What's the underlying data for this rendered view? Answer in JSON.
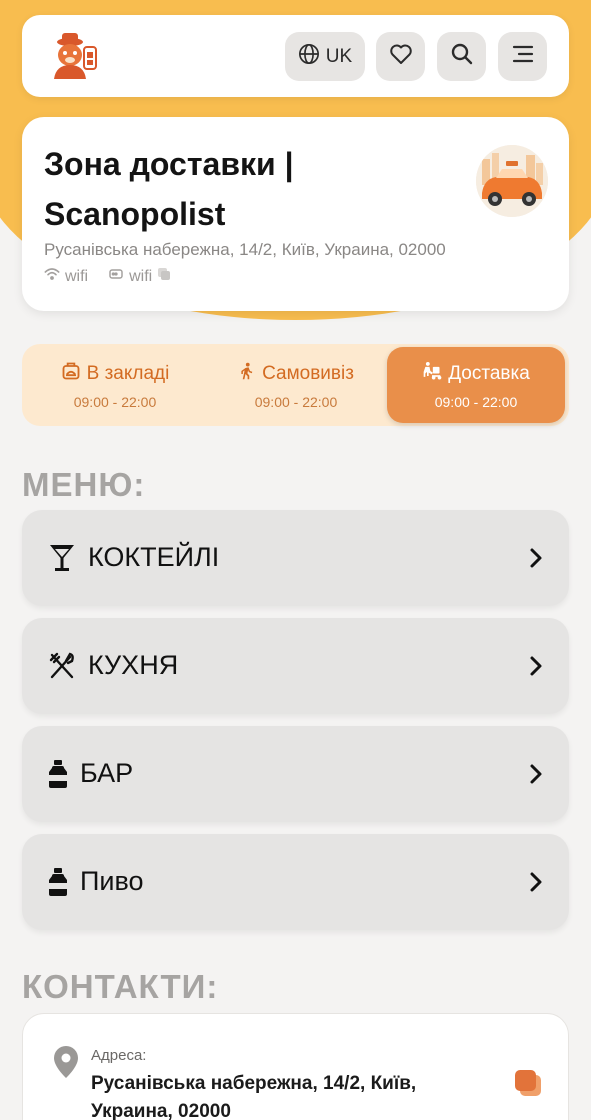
{
  "header": {
    "language": "UK",
    "icons": [
      "globe-icon",
      "heart-icon",
      "search-icon",
      "menu-icon"
    ]
  },
  "venue": {
    "title_line1": "Зона доставки |",
    "title_line2": "Scanopolist",
    "address": "Русанівська набережна, 14/2, Київ, Украина, 02000",
    "wifi_name": "wifi",
    "wifi_password": "wifi"
  },
  "service_tabs": [
    {
      "label": "В закладі",
      "hours": "09:00 - 22:00",
      "icon": "dine-in-icon",
      "active": false
    },
    {
      "label": "Самовивіз",
      "hours": "09:00 - 22:00",
      "icon": "walking-icon",
      "active": false
    },
    {
      "label": "Доставка",
      "hours": "09:00 - 22:00",
      "icon": "delivery-icon",
      "active": true
    }
  ],
  "menu": {
    "title": "МЕНЮ:",
    "items": [
      {
        "label": "КОКТЕЙЛІ",
        "icon": "cocktail-icon"
      },
      {
        "label": "КУХНЯ",
        "icon": "utensils-icon"
      },
      {
        "label": "БАР",
        "icon": "bottle-icon"
      },
      {
        "label": "Пиво",
        "icon": "bottle-icon"
      }
    ]
  },
  "contacts": {
    "title": "КОНТАКТИ:",
    "address_label": "Адреса:",
    "address_value": "Русанівська набережна, 14/2, Київ, Украина, 02000"
  },
  "colors": {
    "background_blob": "#f8bd4f",
    "accent": "#e98f4a",
    "tab_bg": "#fde9cf",
    "tab_text": "#d36b22",
    "menu_item_bg": "#e5e4e3",
    "section_title": "#a6a4a2"
  }
}
